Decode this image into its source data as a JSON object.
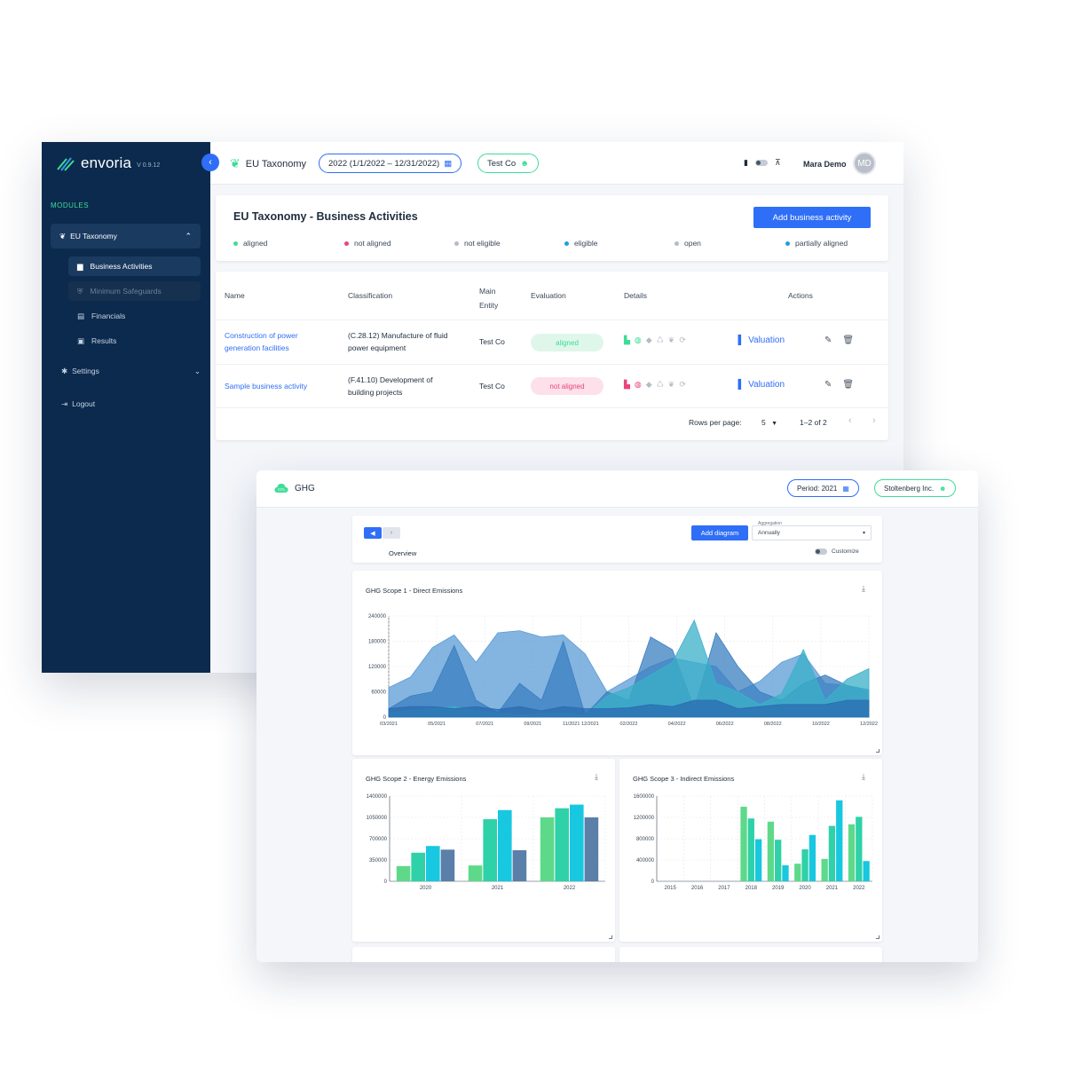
{
  "app": {
    "logo_text": "envoria",
    "version": "V 0.9.12"
  },
  "sidebar": {
    "section_label": "MODULES",
    "group_label": "EU Taxonomy",
    "items": [
      {
        "label": "Business Activities",
        "state": "active"
      },
      {
        "label": "Minimum Safeguards",
        "state": "disabled"
      },
      {
        "label": "Financials",
        "state": "normal"
      },
      {
        "label": "Results",
        "state": "normal"
      }
    ],
    "settings_label": "Settings",
    "logout_label": "Logout"
  },
  "topbar": {
    "module_label": "EU Taxonomy",
    "period": "2022 (1/1/2022 – 12/31/2022)",
    "company": "Test Co",
    "user_name": "Mara Demo",
    "user_initials": "MD"
  },
  "taxonomy": {
    "title": "EU Taxonomy - Business Activities",
    "add_button": "Add business activity",
    "legend": [
      {
        "label": "aligned",
        "color": "#3ddc97"
      },
      {
        "label": "not aligned",
        "color": "#e8457c"
      },
      {
        "label": "not eligible",
        "color": "#b5bcc6"
      },
      {
        "label": "eligible",
        "color": "#1f9fe0"
      },
      {
        "label": "open",
        "color": "#b5bcc6"
      },
      {
        "label": "partially aligned",
        "color": "#1f9fe0"
      }
    ],
    "columns": {
      "name": "Name",
      "classification": "Classification",
      "main_entity_1": "Main",
      "main_entity_2": "Entity",
      "evaluation": "Evaluation",
      "details": "Details",
      "actions": "Actions"
    },
    "rows": [
      {
        "name_1": "Construction of power",
        "name_2": "generation facilities",
        "class_1": "(C.28.12) Manufacture of fluid",
        "class_2": "power equipment",
        "entity": "Test Co",
        "evaluation": "aligned",
        "valuation": "Valuation"
      },
      {
        "name_1": "Sample business activity",
        "name_2": "",
        "class_1": "(F.41.10) Development of",
        "class_2": "building projects",
        "entity": "Test Co",
        "evaluation": "not aligned",
        "valuation": "Valuation"
      }
    ],
    "pagination": {
      "rows_per_page_label": "Rows per page:",
      "rows_per_page": "5",
      "range": "1–2 of 2"
    }
  },
  "ghg": {
    "module_label": "GHG",
    "period": "Period: 2021",
    "company": "Stoltenberg Inc.",
    "add_diagram": "Add diagram",
    "aggregation_label": "Aggregation",
    "aggregation_value": "Annually",
    "tab_overview": "Overview",
    "customize_label": "Customize"
  },
  "colors": {
    "accent": "#2f6ef6",
    "sidebar": "#0c2a4d",
    "green": "#3ddc97",
    "pink": "#e8457c"
  },
  "chart_data": [
    {
      "type": "area",
      "title": "GHG Scope 1 - Direct Emissions",
      "ylim": [
        0,
        240000
      ],
      "yticks": [
        "0",
        "60000",
        "120000",
        "180000",
        "240000"
      ],
      "xticks": [
        "03/2021",
        "05/2021",
        "07/2021",
        "09/2021",
        "11/2021 12/2021",
        "02/2022",
        "04/2022",
        "06/2022",
        "08/2022",
        "10/2022",
        "12/2022"
      ],
      "x_count": 23,
      "series": [
        {
          "values": [
            70000,
            95000,
            165000,
            195000,
            130000,
            200000,
            205000,
            190000,
            195000,
            150000,
            60000,
            90000,
            120000,
            140000,
            130000,
            120000,
            60000,
            85000,
            130000,
            150000,
            80000,
            75000,
            60000
          ],
          "color": "#5b9bd5"
        },
        {
          "values": [
            20000,
            50000,
            60000,
            170000,
            40000,
            10000,
            80000,
            40000,
            180000,
            5000,
            60000,
            40000,
            190000,
            160000,
            20000,
            200000,
            120000,
            60000,
            40000,
            80000,
            100000,
            75000,
            65000
          ],
          "color": "#3a7fc0"
        },
        {
          "values": [
            10000,
            15000,
            20000,
            25000,
            15000,
            10000,
            5000,
            8000,
            10000,
            5000,
            50000,
            70000,
            100000,
            130000,
            230000,
            80000,
            60000,
            30000,
            55000,
            160000,
            40000,
            90000,
            115000
          ],
          "color": "#3ab0c8"
        },
        {
          "values": [
            20000,
            25000,
            25000,
            20000,
            25000,
            18000,
            25000,
            15000,
            25000,
            20000,
            20000,
            22000,
            30000,
            25000,
            40000,
            40000,
            20000,
            25000,
            30000,
            30000,
            30000,
            40000,
            40000
          ],
          "color": "#2a6bb0"
        }
      ]
    },
    {
      "type": "bar",
      "title": "GHG Scope 2 - Energy Emissions",
      "categories": [
        "2020",
        "2021",
        "2022"
      ],
      "ylim": [
        0,
        1400000
      ],
      "yticks": [
        "0",
        "350000",
        "700000",
        "1050000",
        "1400000"
      ],
      "series": [
        {
          "values": [
            250000,
            260000,
            1050000
          ],
          "color": "#5ed98a"
        },
        {
          "values": [
            470000,
            1020000,
            1200000
          ],
          "color": "#2ed1a8"
        },
        {
          "values": [
            580000,
            1170000,
            1260000
          ],
          "color": "#18c7e0"
        },
        {
          "values": [
            520000,
            510000,
            1050000
          ],
          "color": "#5a7fa8"
        }
      ]
    },
    {
      "type": "bar",
      "title": "GHG Scope 3 - Indirect Emissions",
      "categories": [
        "2015",
        "2016",
        "2017",
        "2018",
        "2019",
        "2020",
        "2021",
        "2022"
      ],
      "ylim": [
        0,
        1600000
      ],
      "yticks": [
        "0",
        "400000",
        "800000",
        "1200000",
        "1600000"
      ],
      "series": [
        {
          "values": [
            0,
            0,
            0,
            1400000,
            1120000,
            330000,
            420000,
            1070000
          ],
          "color": "#5ed98a"
        },
        {
          "values": [
            0,
            0,
            0,
            1180000,
            780000,
            600000,
            1040000,
            1210000
          ],
          "color": "#2ed1a8"
        },
        {
          "values": [
            0,
            0,
            0,
            790000,
            300000,
            870000,
            1520000,
            380000
          ],
          "color": "#18c7e0"
        }
      ]
    }
  ]
}
